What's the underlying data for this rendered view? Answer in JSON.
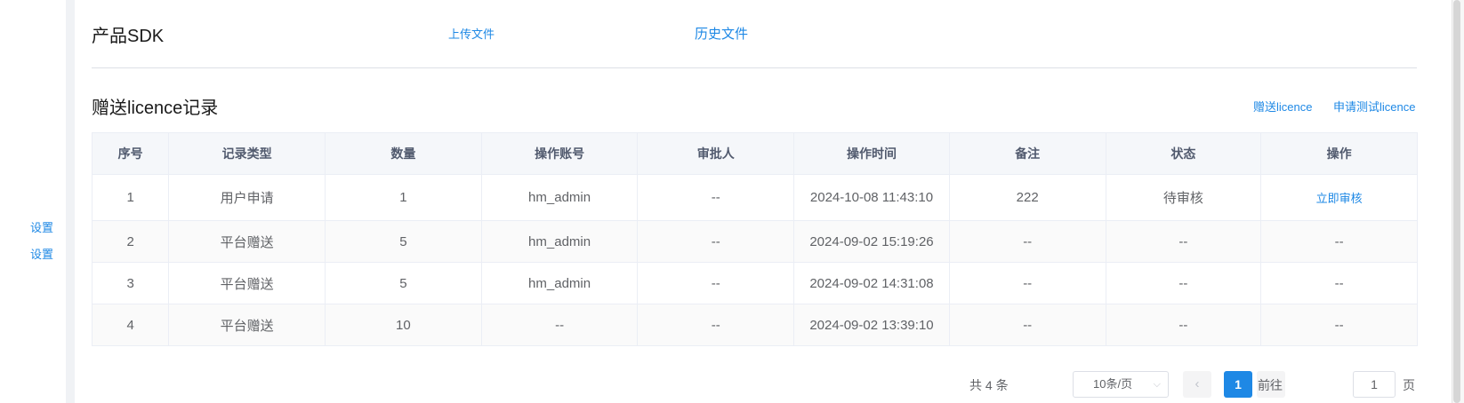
{
  "sidebar": {
    "links": [
      "设置",
      "设置"
    ]
  },
  "sdk": {
    "title": "产品SDK",
    "upload": "上传文件",
    "history": "历史文件"
  },
  "section": {
    "title": "赠送licence记录",
    "gift": "赠送licence",
    "trial": "申请测试licence"
  },
  "table": {
    "headers": [
      "序号",
      "记录类型",
      "数量",
      "操作账号",
      "审批人",
      "操作时间",
      "备注",
      "状态",
      "操作"
    ],
    "rows": [
      [
        "1",
        "用户申请",
        "1",
        "hm_admin",
        "--",
        "2024-10-08 11:43:10",
        "222",
        "待审核",
        "立即审核"
      ],
      [
        "2",
        "平台赠送",
        "5",
        "hm_admin",
        "--",
        "2024-09-02 15:19:26",
        "--",
        "--",
        "--"
      ],
      [
        "3",
        "平台赠送",
        "5",
        "hm_admin",
        "--",
        "2024-09-02 14:31:08",
        "--",
        "--",
        "--"
      ],
      [
        "4",
        "平台赠送",
        "10",
        "--",
        "--",
        "2024-09-02 13:39:10",
        "--",
        "--",
        "--"
      ]
    ]
  },
  "pagination": {
    "total": "共 4 条",
    "page_size": "10条/页",
    "prev": "‹",
    "current": "1",
    "next": "›",
    "goto_label": "前往",
    "goto_value": "1",
    "page_suffix": "页"
  }
}
